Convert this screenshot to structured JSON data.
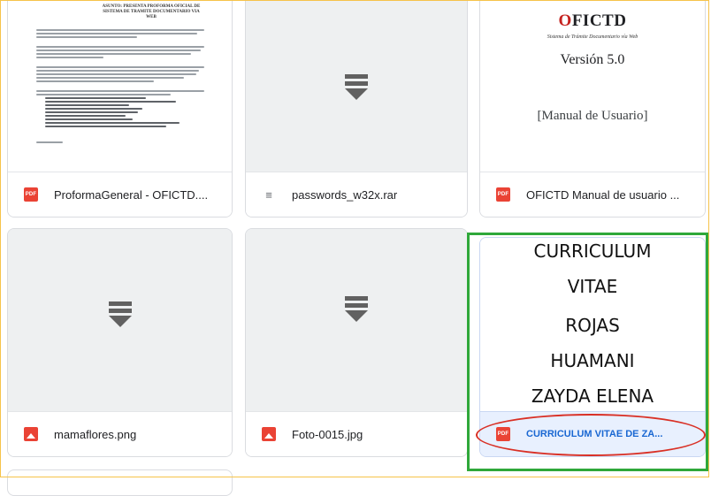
{
  "files": [
    {
      "name": "ProformaGeneral - OFICTD....",
      "type": "pdf"
    },
    {
      "name": "passwords_w32x.rar",
      "type": "rar"
    },
    {
      "name": "OFICTD Manual de usuario ...",
      "type": "pdf"
    },
    {
      "name": "mamaflores.png",
      "type": "image"
    },
    {
      "name": "Foto-0015.jpg",
      "type": "image"
    },
    {
      "name": "CURRICULUM VITAE DE ZA...",
      "type": "pdf"
    }
  ],
  "proforma_preview": {
    "header": "ASUNTO: PRESENTA PROFORMA OFICIAL DE SISTEMA DE TRAMITE DOCUMENTARIO VIA WEB"
  },
  "manual_preview": {
    "logo": "OFICTD",
    "subtitle": "Sistema de Trámite Documentario vía Web",
    "version": "Versión 5.0",
    "manual": "[Manual de Usuario]"
  },
  "cv_preview": {
    "lines": [
      "CURRICULUM",
      "VITAE",
      "ROJAS",
      "HUAMANI",
      "ZAYDA ELENA"
    ]
  },
  "pdf_badge": "PDF",
  "colors": {
    "highlight_green": "#2fa83a",
    "ellipse_red": "#d93025",
    "pdf_red": "#ea4335"
  }
}
